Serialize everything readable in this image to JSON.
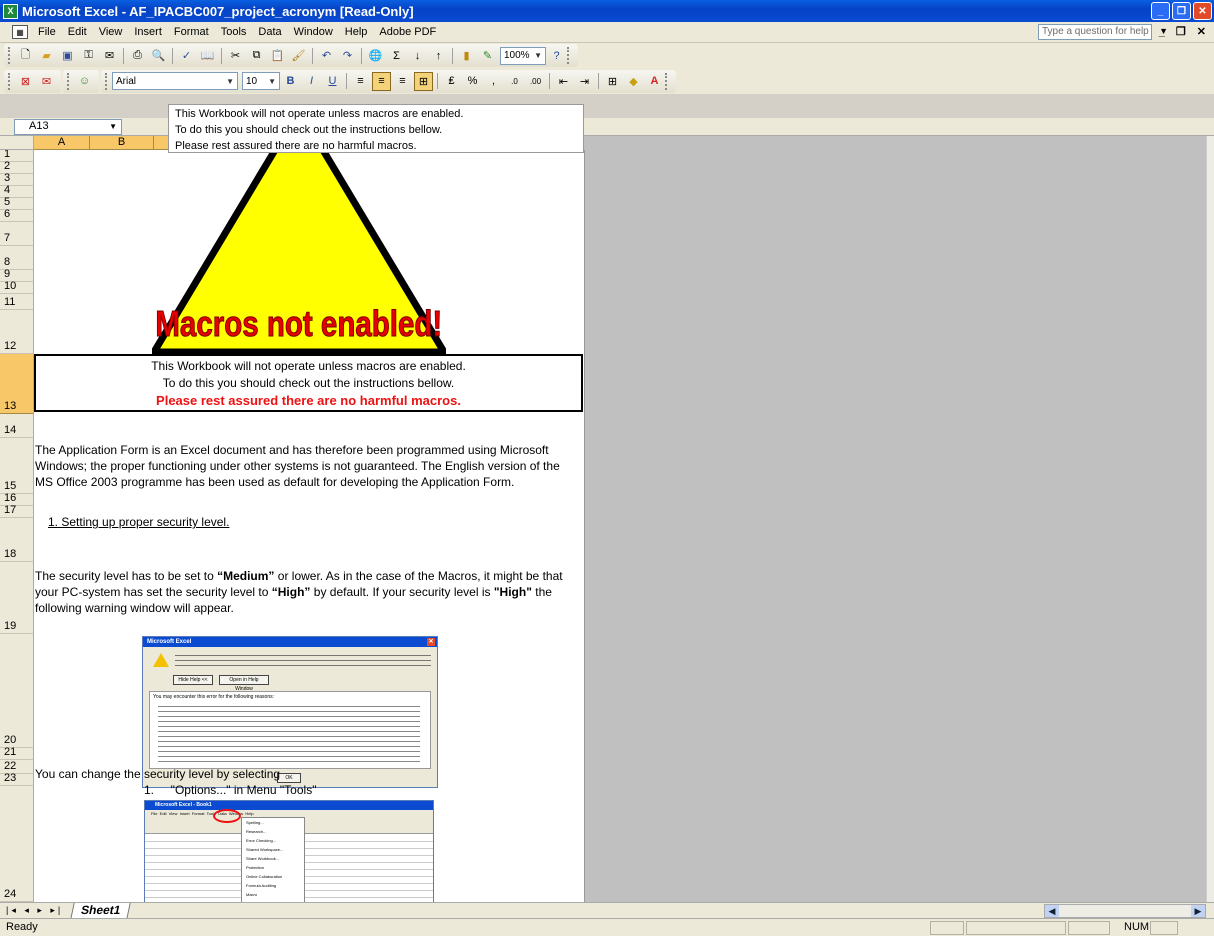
{
  "window": {
    "title": "Microsoft Excel - AF_IPACBC007_project_acronym  [Read-Only]"
  },
  "menubar": {
    "items": [
      "File",
      "Edit",
      "View",
      "Insert",
      "Format",
      "Tools",
      "Data",
      "Window",
      "Help",
      "Adobe PDF"
    ],
    "help_placeholder": "Type a question for help"
  },
  "toolbar": {
    "zoom": "100%",
    "font": "Arial",
    "font_size": "10"
  },
  "formula_bar": {
    "cell_ref": "A13",
    "fx": "fx",
    "content_lines": [
      "This Workbook will not operate unless macros are enabled.",
      "To do this you should check out the instructions bellow.",
      "Please rest assured there are no harmful macros."
    ]
  },
  "columns": [
    "A",
    "B"
  ],
  "rows": [
    "1",
    "2",
    "3",
    "4",
    "5",
    "6",
    "7",
    "8",
    "9",
    "10",
    "11",
    "12",
    "13",
    "14",
    "15",
    "16",
    "17",
    "18",
    "19",
    "20",
    "21",
    "22",
    "23",
    "24"
  ],
  "sheet": {
    "warning_graphic_text": "Macros not enabled!",
    "warning_box": {
      "line1": "This Workbook will not operate unless macros are enabled.",
      "line2": "To do this you should check out the instructions bellow.",
      "line3": "Please rest assured there are no harmful macros."
    },
    "intro_paragraph": "The Application Form is an Excel document and has therefore been programmed using Microsoft Windows; the proper functioning under other systems is not guaranteed. The English version of the MS Office 2003 programme has been used as default for developing the Application Form.",
    "section1_heading": "1. Setting up proper security level.",
    "security_para": {
      "p1": "The security level has to be set to ",
      "b1": "“Medium”",
      "p2": " or lower. As in the case of the Macros, it might be that your PC-system has set the security level to ",
      "b2": "“High”",
      "p3": " by default. If your security level is ",
      "b3": "\"High\"",
      "p4": " the following warning window will appear."
    },
    "dialog_title": "Microsoft Excel",
    "dialog_hide_button": "Hide Help <<",
    "dialog_help_button": "Open in Help Window",
    "dialog_ok": "OK",
    "dialog_reasons": "You may encounter this error for the following reasons:",
    "change_security_text": "You can change the security level by selecting",
    "step1": "1.     \"Options...\" in Menu \"Tools\"",
    "mini_title": "Microsoft Excel - Book1",
    "mini_menu": "File  Edit  View  Insert  Format  Tools  Data  Window  Help",
    "mini_tools_items": [
      "Spelling...",
      "Research...",
      "Error Checking...",
      "Shared Workspace...",
      "Share Workbook...",
      "Protection",
      "Online Collaboration",
      "Formula Auditing",
      "Macro"
    ]
  },
  "sheet_tabs": {
    "active": "Sheet1"
  },
  "status": {
    "left": "Ready",
    "num": "NUM"
  },
  "colors": {
    "title_blue": "#0a4bd2",
    "header_orange": "#f8c868",
    "warning_yellow": "#ffff00",
    "warning_red": "#e11"
  }
}
